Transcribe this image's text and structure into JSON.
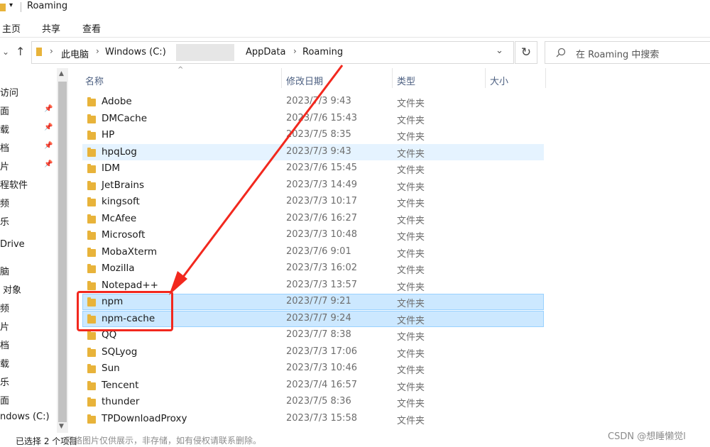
{
  "window": {
    "title": "Roaming"
  },
  "ribbon": {
    "tabs": [
      "主页",
      "共享",
      "查看"
    ]
  },
  "address": {
    "crumbs": [
      "此电脑",
      "Windows (C:)",
      "AppData",
      "Roaming"
    ],
    "search_placeholder": "在 Roaming 中搜索"
  },
  "nav": {
    "items": [
      "访问",
      "面",
      "载",
      "档",
      "片",
      "程软件",
      "频",
      "乐",
      "Drive",
      "脑",
      "对象",
      "频",
      "片",
      "档",
      "载",
      "乐",
      "面",
      "ndows (C:)"
    ]
  },
  "columns": {
    "name": "名称",
    "date": "修改日期",
    "type": "类型",
    "size": "大小"
  },
  "files": [
    {
      "name": "Adobe",
      "date": "2023/7/3 9:43",
      "type": "文件夹"
    },
    {
      "name": "DMCache",
      "date": "2023/7/6 15:43",
      "type": "文件夹"
    },
    {
      "name": "HP",
      "date": "2023/7/5 8:35",
      "type": "文件夹"
    },
    {
      "name": "hpqLog",
      "date": "2023/7/3 9:43",
      "type": "文件夹"
    },
    {
      "name": "IDM",
      "date": "2023/7/6 15:45",
      "type": "文件夹"
    },
    {
      "name": "JetBrains",
      "date": "2023/7/3 14:49",
      "type": "文件夹"
    },
    {
      "name": "kingsoft",
      "date": "2023/7/3 10:17",
      "type": "文件夹"
    },
    {
      "name": "McAfee",
      "date": "2023/7/6 16:27",
      "type": "文件夹"
    },
    {
      "name": "Microsoft",
      "date": "2023/7/3 10:48",
      "type": "文件夹"
    },
    {
      "name": "MobaXterm",
      "date": "2023/7/6 9:01",
      "type": "文件夹"
    },
    {
      "name": "Mozilla",
      "date": "2023/7/3 16:02",
      "type": "文件夹"
    },
    {
      "name": "Notepad++",
      "date": "2023/7/3 13:57",
      "type": "文件夹"
    },
    {
      "name": "npm",
      "date": "2023/7/7 9:21",
      "type": "文件夹"
    },
    {
      "name": "npm-cache",
      "date": "2023/7/7 9:24",
      "type": "文件夹"
    },
    {
      "name": "QQ",
      "date": "2023/7/7 8:38",
      "type": "文件夹"
    },
    {
      "name": "SQLyog",
      "date": "2023/7/3 17:06",
      "type": "文件夹"
    },
    {
      "name": "Sun",
      "date": "2023/7/3 10:46",
      "type": "文件夹"
    },
    {
      "name": "Tencent",
      "date": "2023/7/4 16:57",
      "type": "文件夹"
    },
    {
      "name": "thunder",
      "date": "2023/7/5 8:36",
      "type": "文件夹"
    },
    {
      "name": "TPDownloadProxy",
      "date": "2023/7/3 15:58",
      "type": "文件夹"
    }
  ],
  "selection": {
    "hovered": "hpqLog",
    "selected": [
      "npm",
      "npm-cache"
    ]
  },
  "status": {
    "text": "已选择 2 个项目"
  },
  "overlay": {
    "watermark": "网络图片仅供展示，非存储，如有侵权请联系删除。",
    "credit": "CSDN @想睡懒觉l"
  },
  "colors": {
    "selection": "#cce8ff",
    "selection_border": "#99d1ff",
    "annotation_red": "#f2281e",
    "folder": "#e8b33a"
  }
}
